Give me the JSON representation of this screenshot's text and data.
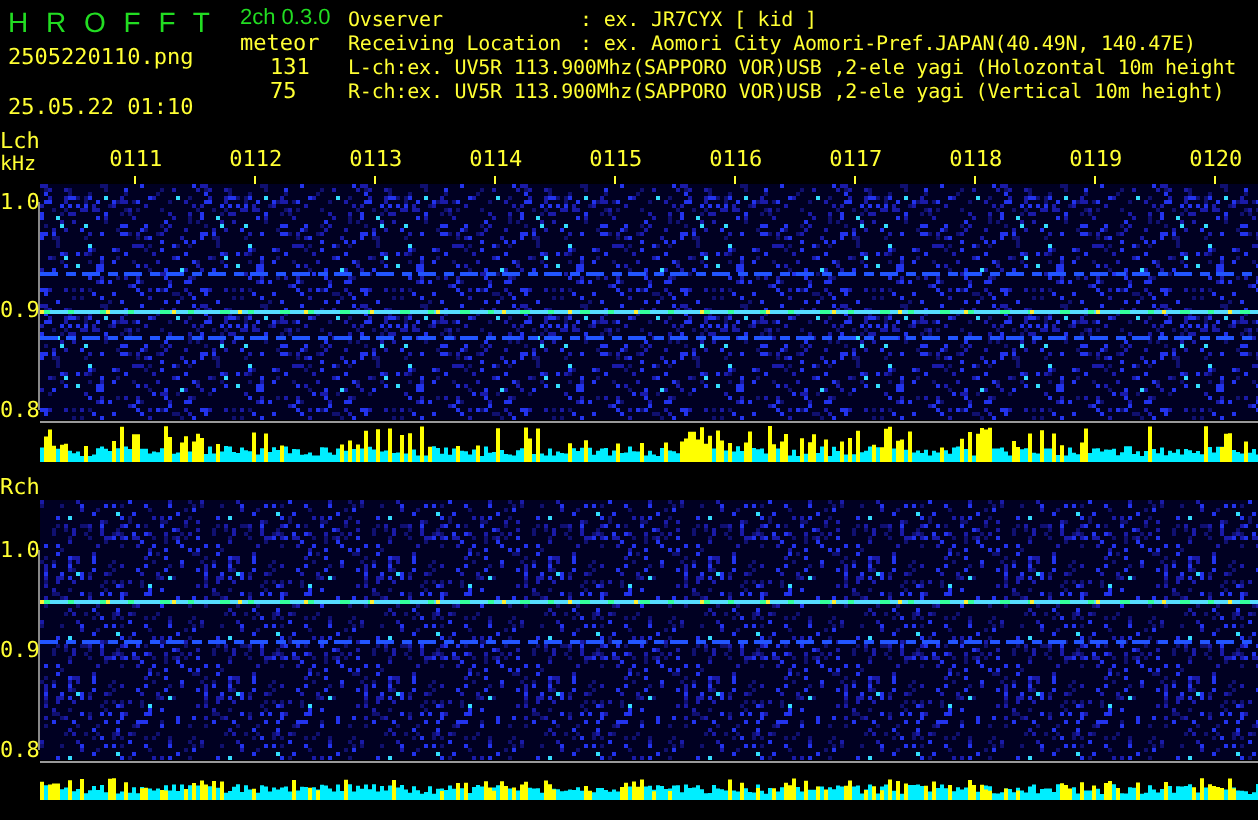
{
  "app": {
    "title": "H R O F F T",
    "version": "2ch 0.3.0",
    "filename": "2505220110.png",
    "datetime": "25.05.22 01:10"
  },
  "meteor": {
    "label": "meteor",
    "counts": [
      "131",
      "75"
    ]
  },
  "info": [
    {
      "label": "Ovserver",
      "value": ": ex. JR7CYX [ kid ]"
    },
    {
      "label": "Receiving Location",
      "value": ": ex. Aomori City Aomori-Pref.JAPAN(40.49N, 140.47E)"
    },
    {
      "label": "L-ch:ex. UV5R 113.900Mhz(SAPPORO VOR)USB ,2-ele yagi (Holozontal 10m height"
    },
    {
      "label": "R-ch:ex. UV5R 113.900Mhz(SAPPORO VOR)USB ,2-ele yagi (Vertical 10m height)"
    }
  ],
  "time_labels": [
    "0111",
    "0112",
    "0113",
    "0114",
    "0115",
    "0116",
    "0117",
    "0118",
    "0119",
    "0120"
  ],
  "channels": [
    {
      "label": "Lch",
      "unit": "kHz",
      "yticks": [
        "1.0",
        "0.9",
        "0.8"
      ]
    },
    {
      "label": "Rch",
      "yticks": [
        "1.0",
        "0.9",
        "0.8"
      ]
    }
  ]
}
